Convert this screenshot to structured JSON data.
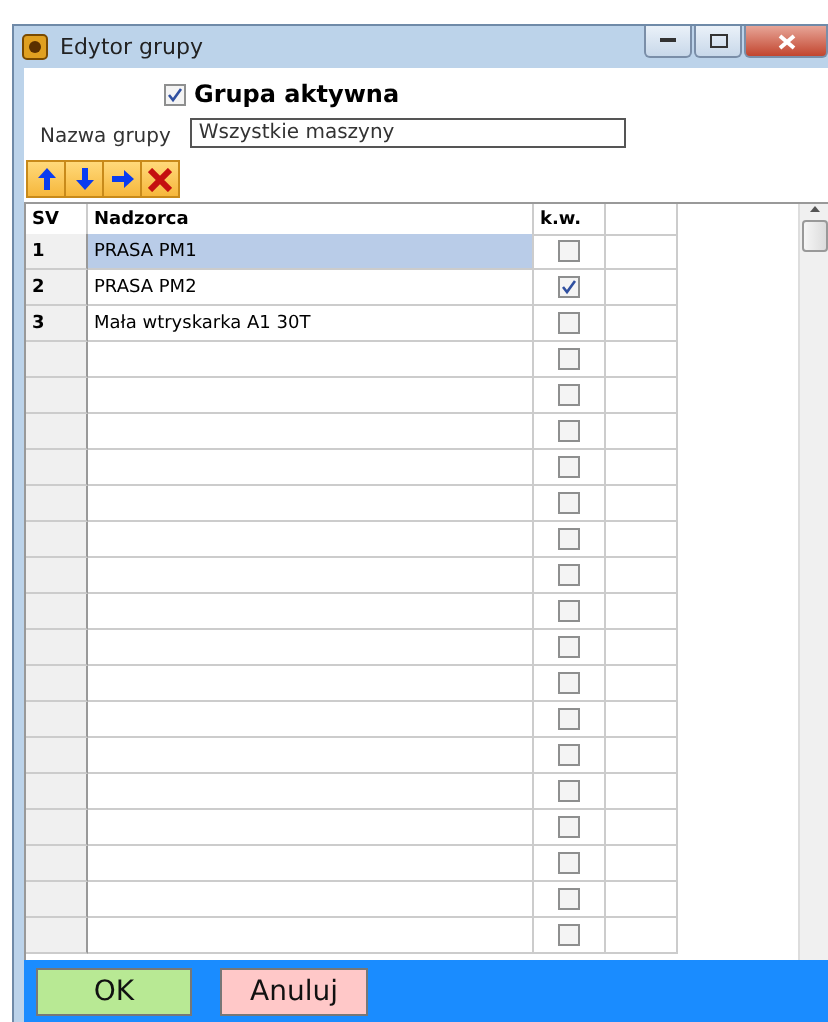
{
  "window": {
    "title": "Edytor grupy"
  },
  "active": {
    "label": "Grupa aktywna",
    "checked": true
  },
  "group_name": {
    "label": "Nazwa grupy",
    "value": "Wszystkie maszyny"
  },
  "toolbar": [
    {
      "kind": "up"
    },
    {
      "kind": "down"
    },
    {
      "kind": "right"
    },
    {
      "kind": "delete"
    }
  ],
  "table": {
    "columns": [
      "SV",
      "Nadzorca",
      "k.w."
    ],
    "rows": [
      {
        "sv": "1",
        "name": "PRASA PM1",
        "kw": false,
        "selected": true
      },
      {
        "sv": "2",
        "name": "PRASA PM2",
        "kw": true,
        "selected": false
      },
      {
        "sv": "3",
        "name": "Mała wtryskarka A1 30T",
        "kw": false,
        "selected": false
      },
      {
        "kw": false,
        "selected": false
      },
      {
        "kw": false,
        "selected": false
      },
      {
        "kw": false,
        "selected": false
      },
      {
        "kw": false,
        "selected": false
      },
      {
        "kw": false,
        "selected": false
      },
      {
        "kw": false,
        "selected": false
      },
      {
        "kw": false,
        "selected": false
      },
      {
        "kw": false,
        "selected": false
      },
      {
        "kw": false,
        "selected": false
      },
      {
        "kw": false,
        "selected": false
      },
      {
        "kw": false,
        "selected": false
      },
      {
        "kw": false,
        "selected": false
      },
      {
        "kw": false,
        "selected": false
      },
      {
        "kw": false,
        "selected": false
      },
      {
        "kw": false,
        "selected": false
      },
      {
        "kw": false,
        "selected": false
      },
      {
        "kw": false,
        "selected": false
      }
    ]
  },
  "buttons": [
    {
      "kind": "ok",
      "label": "OK"
    },
    {
      "kind": "cancel",
      "label": "Anuluj"
    }
  ]
}
